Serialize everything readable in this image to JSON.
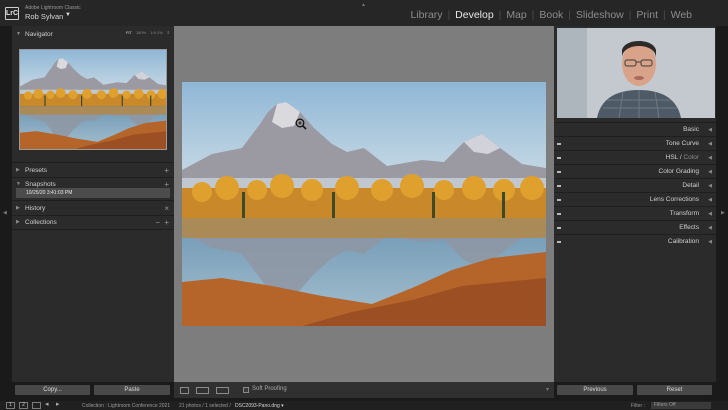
{
  "app": {
    "logo_text": "LrC",
    "app_name": "Adobe Lightroom Classic",
    "user_name": "Rob Sylvan",
    "user_caret": "▼"
  },
  "modules": [
    {
      "label": "Library",
      "active": false
    },
    {
      "label": "Develop",
      "active": true
    },
    {
      "label": "Map",
      "active": false
    },
    {
      "label": "Book",
      "active": false
    },
    {
      "label": "Slideshow",
      "active": false
    },
    {
      "label": "Print",
      "active": false
    },
    {
      "label": "Web",
      "active": false
    }
  ],
  "module_separator": "|",
  "left_panel": {
    "navigator": {
      "title": "Navigator",
      "zoom_options": [
        "FIT",
        "100%",
        "1:9.1%"
      ],
      "zoom_selected": "FIT",
      "zoom_caret": "⇕"
    },
    "presets": {
      "title": "Presets",
      "action": "+"
    },
    "snapshots": {
      "title": "Snapshots",
      "action": "+",
      "items": [
        "10/25/20 3:41:03 PM"
      ]
    },
    "history": {
      "title": "History",
      "action": "×"
    },
    "collections": {
      "title": "Collections",
      "actions": [
        "−",
        "+"
      ]
    },
    "copy_label": "Copy...",
    "paste_label": "Paste"
  },
  "toolbar": {
    "soft_proofing_label": "Soft Proofing",
    "soft_proofing_checked": false,
    "caret": "▾"
  },
  "right_panel": {
    "sections": [
      {
        "label": "Basic",
        "has_switch": false
      },
      {
        "label": "Tone Curve",
        "has_switch": true
      },
      {
        "label": "HSL",
        "sep": " / ",
        "label_dim": "Color",
        "has_switch": true
      },
      {
        "label": "Color Grading",
        "has_switch": true
      },
      {
        "label": "Detail",
        "has_switch": true
      },
      {
        "label": "Lens Corrections",
        "has_switch": true
      },
      {
        "label": "Transform",
        "has_switch": true
      },
      {
        "label": "Effects",
        "has_switch": true
      },
      {
        "label": "Calibration",
        "has_switch": true
      }
    ],
    "previous_label": "Previous",
    "reset_label": "Reset"
  },
  "filmstrip": {
    "page_buttons": [
      "1",
      "2"
    ],
    "breadcrumb": "Collection : Lightroom Conference 2021",
    "count": "21 photos / 1 selected /",
    "filename": "DSC2093-Pano.dng",
    "filename_caret": "▾",
    "filter_label": "Filter :",
    "filter_value": "Filters Off"
  },
  "icons": {
    "panel_open": "▼",
    "panel_closed": "▶",
    "right_panel_tri": "◀",
    "edge_left": "◀",
    "edge_right": "▶",
    "edge_up": "▲",
    "edge_down": "▼"
  },
  "colors": {
    "background": "#1a1a1a",
    "panel": "#2b2b2b",
    "center": "#7d7d7d",
    "active_module": "#e8e8e8",
    "inactive_module": "#8c8c8c"
  }
}
